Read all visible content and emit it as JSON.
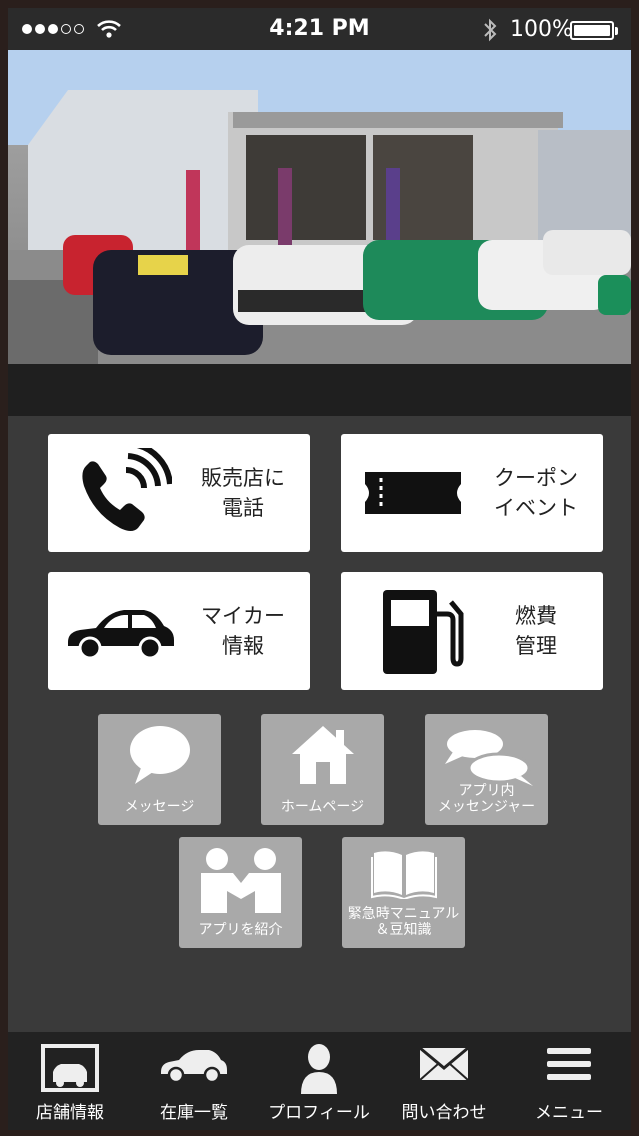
{
  "status_bar": {
    "time": "4:21 PM",
    "battery": "100%"
  },
  "main_tiles": [
    {
      "label": "販売店に\n電話",
      "icon": "phone-icon"
    },
    {
      "label": "クーポン\nイベント",
      "icon": "ticket-icon"
    },
    {
      "label": "マイカー\n情報",
      "icon": "car-icon"
    },
    {
      "label": "燃費\n管理",
      "icon": "fuel-pump-icon"
    }
  ],
  "small_tiles": [
    {
      "label": "メッセージ",
      "icon": "speech-bubble-icon"
    },
    {
      "label": "ホームページ",
      "icon": "house-icon"
    },
    {
      "label": "アプリ内\nメッセンジャー",
      "icon": "chat-bubbles-icon"
    },
    {
      "label": "アプリを紹介",
      "icon": "people-icon"
    },
    {
      "label": "緊急時マニュアル\n＆豆知識",
      "icon": "book-icon"
    }
  ],
  "tab_bar": [
    {
      "label": "店舗情報",
      "icon": "garage-icon"
    },
    {
      "label": "在庫一覧",
      "icon": "car-icon"
    },
    {
      "label": "プロフィール",
      "icon": "person-icon"
    },
    {
      "label": "問い合わせ",
      "icon": "envelope-icon"
    },
    {
      "label": "メニュー",
      "icon": "hamburger-menu-icon"
    }
  ],
  "colors": {
    "tile_bg": "#ffffff",
    "small_tile_bg": "#a9a9a9",
    "background": "#3a3a3a",
    "tab_bar_bg": "#222222"
  }
}
